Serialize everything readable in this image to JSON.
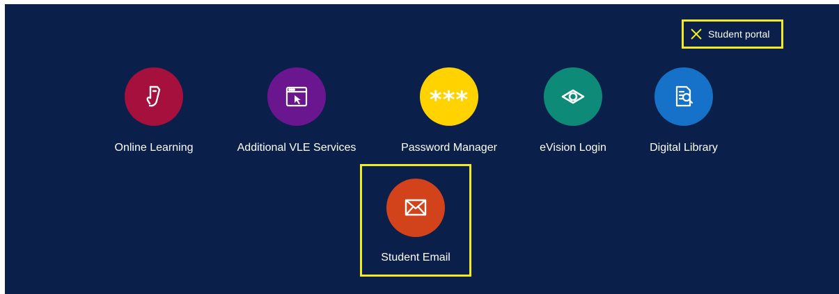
{
  "close_button": {
    "label": "Student portal",
    "accent": "#f4ea1c"
  },
  "tiles": [
    {
      "label": "Online Learning",
      "color": "#a5103c",
      "icon": "hand-phone-icon"
    },
    {
      "label": "Additional VLE Services",
      "color": "#6a168f",
      "icon": "browser-cursor-icon"
    },
    {
      "label": "Password Manager",
      "color": "#ffd200",
      "icon": "asterisks-icon",
      "icon_text": "***"
    },
    {
      "label": "eVision Login",
      "color": "#0e8a79",
      "icon": "eye-icon"
    },
    {
      "label": "Digital Library",
      "color": "#1572c8",
      "icon": "document-search-icon"
    },
    {
      "label": "Student Email",
      "color": "#d2431c",
      "icon": "envelope-icon"
    }
  ],
  "background": "#0b1f4b"
}
